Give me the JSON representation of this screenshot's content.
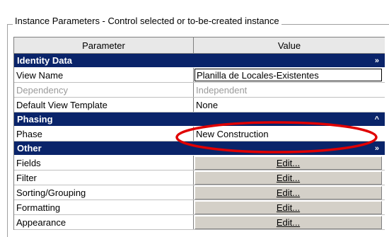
{
  "group_title": "Instance Parameters - Control selected or to-be-created instance",
  "columns": {
    "parameter": "Parameter",
    "value": "Value"
  },
  "sections": [
    {
      "title": "Identity Data",
      "toggle": "»",
      "rows": [
        {
          "name": "View Name",
          "value": "Planilla de Locales-Existentes"
        },
        {
          "name": "Dependency",
          "value": "Independent"
        },
        {
          "name": "Default View Template",
          "value": "None"
        }
      ]
    },
    {
      "title": "Phasing",
      "toggle": "^",
      "rows": [
        {
          "name": "Phase",
          "value": "New Construction"
        }
      ]
    },
    {
      "title": "Other",
      "toggle": "»",
      "rows": [
        {
          "name": "Fields",
          "value": "Edit..."
        },
        {
          "name": "Filter",
          "value": "Edit..."
        },
        {
          "name": "Sorting/Grouping",
          "value": "Edit..."
        },
        {
          "name": "Formatting",
          "value": "Edit..."
        },
        {
          "name": "Appearance",
          "value": "Edit..."
        }
      ]
    }
  ],
  "colors": {
    "section_bg": "#0a246a",
    "annotation": "#e00000"
  }
}
